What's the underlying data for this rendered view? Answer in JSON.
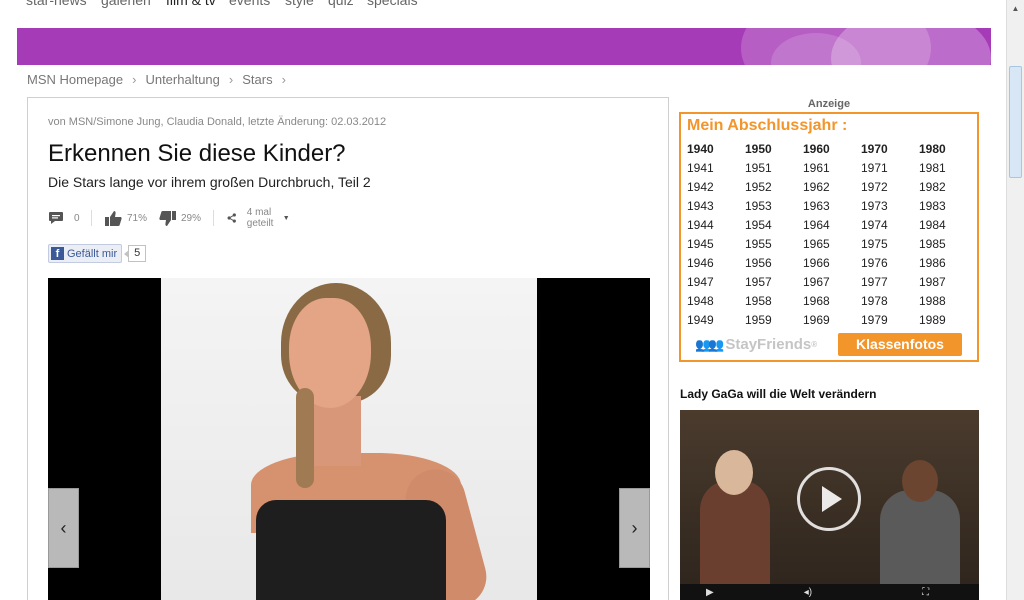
{
  "topnav": {
    "items": [
      "star-news",
      "galerien",
      "film & tv",
      "events",
      "style",
      "quiz",
      "specials"
    ]
  },
  "breadcrumb": [
    "MSN Homepage",
    "Unterhaltung",
    "Stars"
  ],
  "article": {
    "byline": "von MSN/Simone Jung, Claudia Donald, letzte Änderung: 02.03.2012",
    "title": "Erkennen Sie diese Kinder?",
    "subtitle": "Die Stars lange vor ihrem großen Durchbruch, Teil 2",
    "actions": {
      "comments": "0",
      "likes_pct": "71%",
      "dislikes_pct": "29%",
      "shared": "4 mal geteilt"
    },
    "facebook": {
      "label": "Gefällt mir",
      "count": "5"
    }
  },
  "sidebar": {
    "ad_label": "Anzeige",
    "ad": {
      "title": "Mein Abschlussjahr :",
      "years": [
        [
          "1940",
          "1950",
          "1960",
          "1970",
          "1980"
        ],
        [
          "1941",
          "1951",
          "1961",
          "1971",
          "1981"
        ],
        [
          "1942",
          "1952",
          "1962",
          "1972",
          "1982"
        ],
        [
          "1943",
          "1953",
          "1963",
          "1973",
          "1983"
        ],
        [
          "1944",
          "1954",
          "1964",
          "1974",
          "1984"
        ],
        [
          "1945",
          "1955",
          "1965",
          "1975",
          "1985"
        ],
        [
          "1946",
          "1956",
          "1966",
          "1976",
          "1986"
        ],
        [
          "1947",
          "1957",
          "1967",
          "1977",
          "1987"
        ],
        [
          "1948",
          "1958",
          "1968",
          "1978",
          "1988"
        ],
        [
          "1949",
          "1959",
          "1969",
          "1979",
          "1989"
        ]
      ],
      "brand": "StayFriends",
      "cta": "Klassenfotos",
      "accent": "#f2962c"
    },
    "video_title": "Lady GaGa will die Welt verändern"
  },
  "colors": {
    "banner": "#a63bb8"
  }
}
